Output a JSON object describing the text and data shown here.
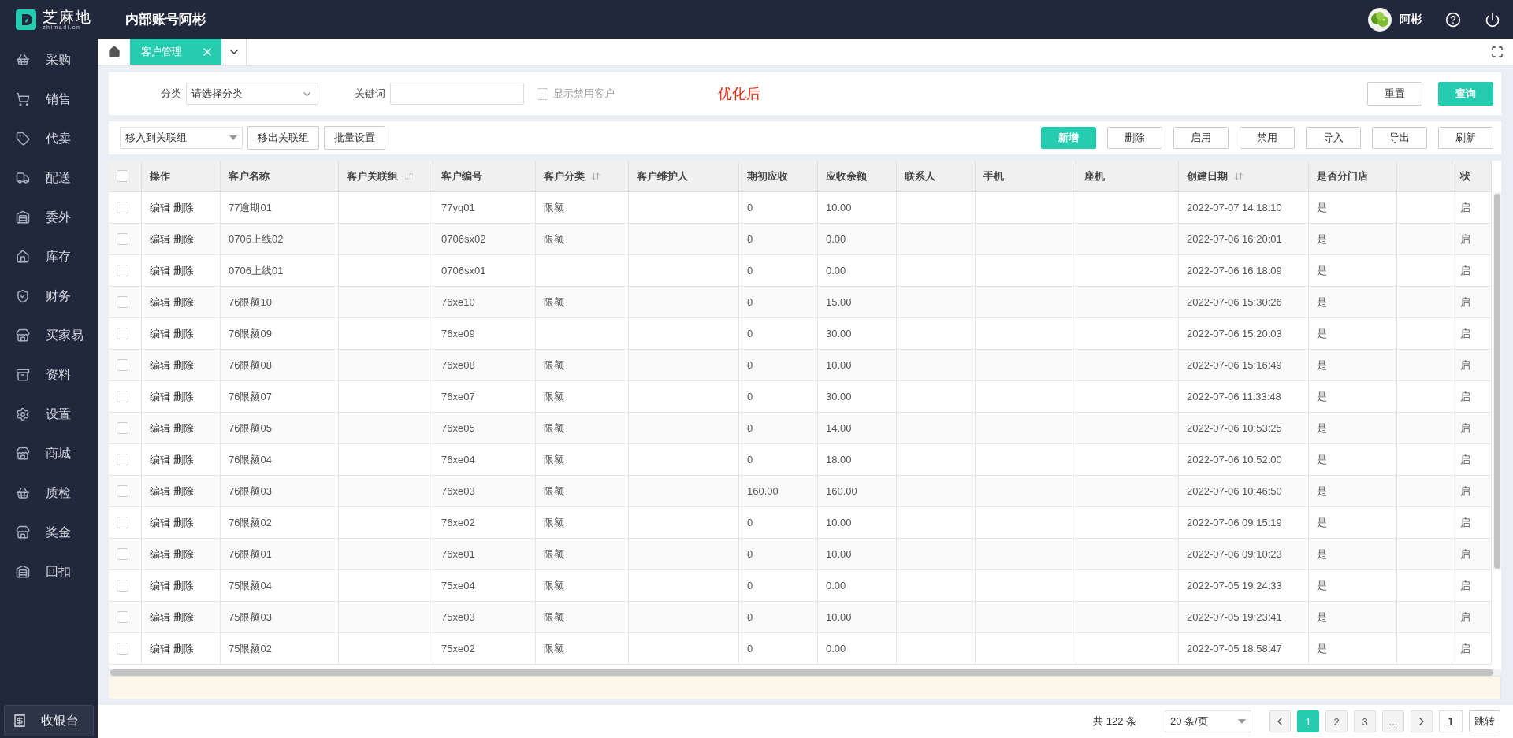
{
  "header": {
    "brand": "芝麻地",
    "brand_sub": "zhimadi.cn",
    "account": "内部账号阿彬",
    "user": "阿彬"
  },
  "sidebar": {
    "items": [
      {
        "label": "采购",
        "kind": "basket"
      },
      {
        "label": "销售",
        "kind": "cart"
      },
      {
        "label": "代卖",
        "kind": "tag"
      },
      {
        "label": "配送",
        "kind": "truck"
      },
      {
        "label": "委外",
        "kind": "warehouse"
      },
      {
        "label": "库存",
        "kind": "home"
      },
      {
        "label": "财务",
        "kind": "shield"
      },
      {
        "label": "买家易",
        "kind": "store"
      },
      {
        "label": "资料",
        "kind": "archive"
      },
      {
        "label": "设置",
        "kind": "gear"
      },
      {
        "label": "商城",
        "kind": "store"
      },
      {
        "label": "质检",
        "kind": "basket"
      },
      {
        "label": "奖金",
        "kind": "store"
      },
      {
        "label": "回扣",
        "kind": "warehouse"
      }
    ],
    "cashier": "收银台"
  },
  "tabs": [
    {
      "label": "客户管理",
      "selected": true
    }
  ],
  "filter": {
    "category_label": "分类",
    "category_placeholder": "请选择分类",
    "keyword_label": "关键词",
    "show_disabled": {
      "label": "显示禁用客户",
      "checked": false
    },
    "note": "优化后",
    "reset": "重置",
    "query": "查询"
  },
  "toolbar": {
    "group_select": "移入到关联组",
    "left_buttons": [
      "移出关联组",
      "批量设置"
    ],
    "right_buttons": [
      {
        "label": "新增",
        "kind": "primary"
      },
      {
        "label": "删除",
        "kind": "plain"
      },
      {
        "label": "启用",
        "kind": "plain"
      },
      {
        "label": "禁用",
        "kind": "plain"
      },
      {
        "label": "导入",
        "kind": "plain"
      },
      {
        "label": "导出",
        "kind": "plain"
      },
      {
        "label": "刷新",
        "kind": "plain"
      }
    ]
  },
  "table": {
    "select_all_checked": false,
    "columns": [
      {
        "label": "操作",
        "sortable": false
      },
      {
        "label": "客户名称",
        "sortable": false
      },
      {
        "label": "客户关联组",
        "sortable": true
      },
      {
        "label": "客户编号",
        "sortable": false
      },
      {
        "label": "客户分类",
        "sortable": true
      },
      {
        "label": "客户维护人",
        "sortable": false
      },
      {
        "label": "期初应收",
        "sortable": false
      },
      {
        "label": "应收余额",
        "sortable": false
      },
      {
        "label": "联系人",
        "sortable": false
      },
      {
        "label": "手机",
        "sortable": false
      },
      {
        "label": "座机",
        "sortable": false
      },
      {
        "label": "创建日期",
        "sortable": true
      },
      {
        "label": "是否分门店",
        "sortable": false
      },
      {
        "label": "状",
        "sortable": false
      }
    ],
    "rows": [
      {
        "checked": false,
        "actions": [
          "编辑",
          "删除"
        ],
        "name": "77逾期01",
        "code": "77yq01",
        "category": "限额",
        "initial": "0",
        "balance": "10.00",
        "created": "2022-07-07 14:18:10",
        "branch": "是",
        "status": "启"
      },
      {
        "checked": false,
        "actions": [
          "编辑",
          "删除"
        ],
        "name": "0706上线02",
        "code": "0706sx02",
        "category": "限额",
        "initial": "0",
        "balance": "0.00",
        "created": "2022-07-06 16:20:01",
        "branch": "是",
        "status": "启"
      },
      {
        "checked": false,
        "actions": [
          "编辑",
          "删除"
        ],
        "name": "0706上线01",
        "code": "0706sx01",
        "initial": "0",
        "balance": "0.00",
        "created": "2022-07-06 16:18:09",
        "branch": "是",
        "status": "启"
      },
      {
        "checked": false,
        "actions": [
          "编辑",
          "删除"
        ],
        "name": "76限额10",
        "code": "76xe10",
        "category": "限额",
        "initial": "0",
        "balance": "15.00",
        "created": "2022-07-06 15:30:26",
        "branch": "是",
        "status": "启"
      },
      {
        "checked": false,
        "actions": [
          "编辑",
          "删除"
        ],
        "name": "76限额09",
        "code": "76xe09",
        "initial": "0",
        "balance": "30.00",
        "created": "2022-07-06 15:20:03",
        "branch": "是",
        "status": "启"
      },
      {
        "checked": false,
        "actions": [
          "编辑",
          "删除"
        ],
        "name": "76限额08",
        "code": "76xe08",
        "category": "限额",
        "initial": "0",
        "balance": "10.00",
        "created": "2022-07-06 15:16:49",
        "branch": "是",
        "status": "启"
      },
      {
        "checked": false,
        "actions": [
          "编辑",
          "删除"
        ],
        "name": "76限额07",
        "code": "76xe07",
        "category": "限额",
        "initial": "0",
        "balance": "30.00",
        "created": "2022-07-06 11:33:48",
        "branch": "是",
        "status": "启"
      },
      {
        "checked": false,
        "actions": [
          "编辑",
          "删除"
        ],
        "name": "76限额05",
        "code": "76xe05",
        "category": "限额",
        "initial": "0",
        "balance": "14.00",
        "created": "2022-07-06 10:53:25",
        "branch": "是",
        "status": "启"
      },
      {
        "checked": false,
        "actions": [
          "编辑",
          "删除"
        ],
        "name": "76限额04",
        "code": "76xe04",
        "category": "限额",
        "initial": "0",
        "balance": "18.00",
        "created": "2022-07-06 10:52:00",
        "branch": "是",
        "status": "启"
      },
      {
        "checked": false,
        "actions": [
          "编辑",
          "删除"
        ],
        "name": "76限额03",
        "code": "76xe03",
        "category": "限额",
        "initial": "160.00",
        "balance": "160.00",
        "created": "2022-07-06 10:46:50",
        "branch": "是",
        "status": "启"
      },
      {
        "checked": false,
        "actions": [
          "编辑",
          "删除"
        ],
        "name": "76限额02",
        "code": "76xe02",
        "category": "限额",
        "initial": "0",
        "balance": "10.00",
        "created": "2022-07-06 09:15:19",
        "branch": "是",
        "status": "启"
      },
      {
        "checked": false,
        "actions": [
          "编辑",
          "删除"
        ],
        "name": "76限额01",
        "code": "76xe01",
        "category": "限额",
        "initial": "0",
        "balance": "10.00",
        "created": "2022-07-06 09:10:23",
        "branch": "是",
        "status": "启"
      },
      {
        "checked": false,
        "actions": [
          "编辑",
          "删除"
        ],
        "name": "75限额04",
        "code": "75xe04",
        "category": "限额",
        "initial": "0",
        "balance": "0.00",
        "created": "2022-07-05 19:24:33",
        "branch": "是",
        "status": "启"
      },
      {
        "checked": false,
        "actions": [
          "编辑",
          "删除"
        ],
        "name": "75限额03",
        "code": "75xe03",
        "category": "限额",
        "initial": "0",
        "balance": "10.00",
        "created": "2022-07-05 19:23:41",
        "branch": "是",
        "status": "启"
      },
      {
        "checked": false,
        "actions": [
          "编辑",
          "删除"
        ],
        "name": "75限额02",
        "code": "75xe02",
        "category": "限额",
        "initial": "0",
        "balance": "0.00",
        "created": "2022-07-05 18:58:47",
        "branch": "是",
        "status": "启"
      }
    ]
  },
  "pagination": {
    "total": "共 122 条",
    "page_size": "20 条/页",
    "pages": [
      {
        "label": "1",
        "selected": true
      },
      {
        "label": "2",
        "selected": false
      },
      {
        "label": "3",
        "selected": false
      },
      {
        "label": "...",
        "selected": false
      }
    ],
    "jump_value": "1",
    "jump": "跳转"
  }
}
